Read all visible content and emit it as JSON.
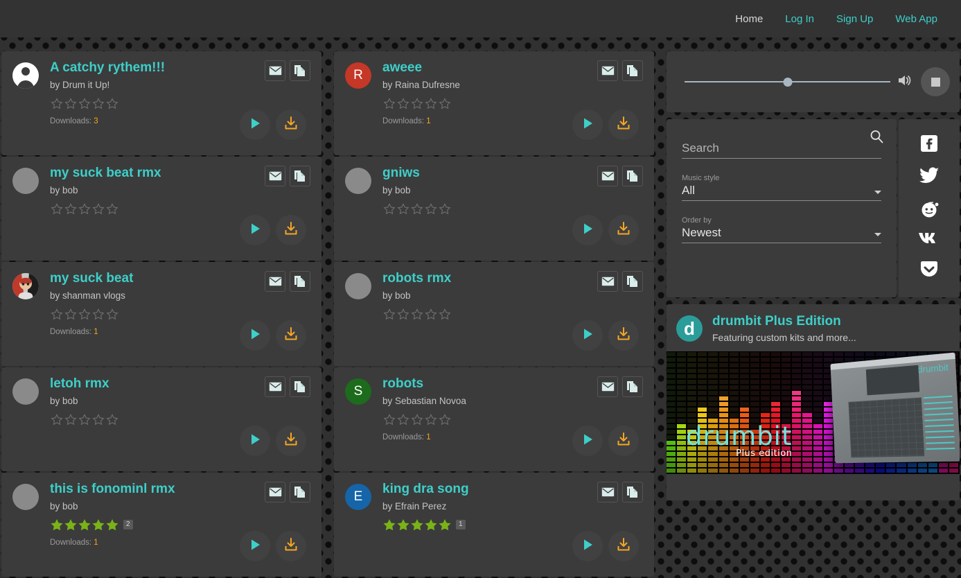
{
  "nav": {
    "items": [
      {
        "label": "Home",
        "name": "nav-home"
      },
      {
        "label": "Log In",
        "name": "nav-login"
      },
      {
        "label": "Sign Up",
        "name": "nav-signup"
      },
      {
        "label": "Web App",
        "name": "nav-webapp"
      }
    ]
  },
  "colors": {
    "accent_teal": "#3ecfc9",
    "download_orange": "#f5a623",
    "star_filled": "#7ab317",
    "card_bg": "#3b3b3b",
    "page_bg": "#313131"
  },
  "tracks": [
    {
      "title": "A catchy rythem!!!",
      "author_prefix": "by",
      "author": "Drum it Up!",
      "rating": 0,
      "rating_count": null,
      "downloads_label": "Downloads:",
      "downloads": "3",
      "avatar_type": "default-person",
      "avatar_letter": "",
      "avatar_color": "#ffffff"
    },
    {
      "title": "aweee",
      "author_prefix": "by",
      "author": "Raina Dufresne",
      "rating": 0,
      "rating_count": null,
      "downloads_label": "Downloads:",
      "downloads": "1",
      "avatar_type": "letter",
      "avatar_letter": "R",
      "avatar_color": "#c53727"
    },
    {
      "title": "my suck beat rmx",
      "author_prefix": "by",
      "author": "bob",
      "rating": 0,
      "rating_count": null,
      "downloads_label": "",
      "downloads": "",
      "avatar_type": "blank",
      "avatar_letter": "",
      "avatar_color": "#8a8a8a"
    },
    {
      "title": "gniws",
      "author_prefix": "by",
      "author": "bob",
      "rating": 0,
      "rating_count": null,
      "downloads_label": "",
      "downloads": "",
      "avatar_type": "blank",
      "avatar_letter": "",
      "avatar_color": "#8a8a8a"
    },
    {
      "title": "my suck beat",
      "author_prefix": "by",
      "author": "shanman vlogs",
      "rating": 0,
      "rating_count": null,
      "downloads_label": "Downloads:",
      "downloads": "1",
      "avatar_type": "photo",
      "avatar_letter": "",
      "avatar_color": "#b33a2c"
    },
    {
      "title": "robots rmx",
      "author_prefix": "by",
      "author": "bob",
      "rating": 0,
      "rating_count": null,
      "downloads_label": "",
      "downloads": "",
      "avatar_type": "blank",
      "avatar_letter": "",
      "avatar_color": "#8a8a8a"
    },
    {
      "title": "letoh rmx",
      "author_prefix": "by",
      "author": "bob",
      "rating": 0,
      "rating_count": null,
      "downloads_label": "",
      "downloads": "",
      "avatar_type": "blank",
      "avatar_letter": "",
      "avatar_color": "#8a8a8a"
    },
    {
      "title": "robots",
      "author_prefix": "by",
      "author": "Sebastian Novoa",
      "rating": 0,
      "rating_count": null,
      "downloads_label": "Downloads:",
      "downloads": "1",
      "avatar_type": "letter",
      "avatar_letter": "S",
      "avatar_color": "#1d6b1d"
    },
    {
      "title": "this is fonominl rmx",
      "author_prefix": "by",
      "author": "bob",
      "rating": 5,
      "rating_count": "2",
      "downloads_label": "Downloads:",
      "downloads": "1",
      "avatar_type": "blank",
      "avatar_letter": "",
      "avatar_color": "#8a8a8a"
    },
    {
      "title": "king dra song",
      "author_prefix": "by",
      "author": "Efrain Perez",
      "rating": 5,
      "rating_count": "1",
      "downloads_label": "",
      "downloads": "",
      "avatar_type": "letter",
      "avatar_letter": "E",
      "avatar_color": "#1565a8"
    }
  ],
  "card_buttons": {
    "email_icon": "envelope-icon",
    "copy_icon": "copy-icon",
    "play_icon": "play-icon",
    "download_icon": "download-icon"
  },
  "player": {
    "volume_percent": 50,
    "speaker_icon": "volume-icon",
    "stop_icon": "stop-icon"
  },
  "filters": {
    "search": {
      "placeholder": "Search",
      "value": ""
    },
    "search_icon": "search-icon",
    "music_style": {
      "label": "Music style",
      "value": "All"
    },
    "order_by": {
      "label": "Order by",
      "value": "Newest"
    }
  },
  "social": [
    {
      "name": "facebook-icon",
      "label": "Facebook"
    },
    {
      "name": "twitter-icon",
      "label": "Twitter"
    },
    {
      "name": "reddit-icon",
      "label": "Reddit"
    },
    {
      "name": "vk-icon",
      "label": "VK"
    },
    {
      "name": "pocket-icon",
      "label": "Pocket"
    }
  ],
  "ad": {
    "logo_letter": "d",
    "title": "drumbit Plus Edition",
    "subtitle": "Featuring custom kits and more...",
    "banner_wordmark": "drumbit",
    "banner_sub": "Plus edition",
    "app_brand": "drumbit"
  }
}
